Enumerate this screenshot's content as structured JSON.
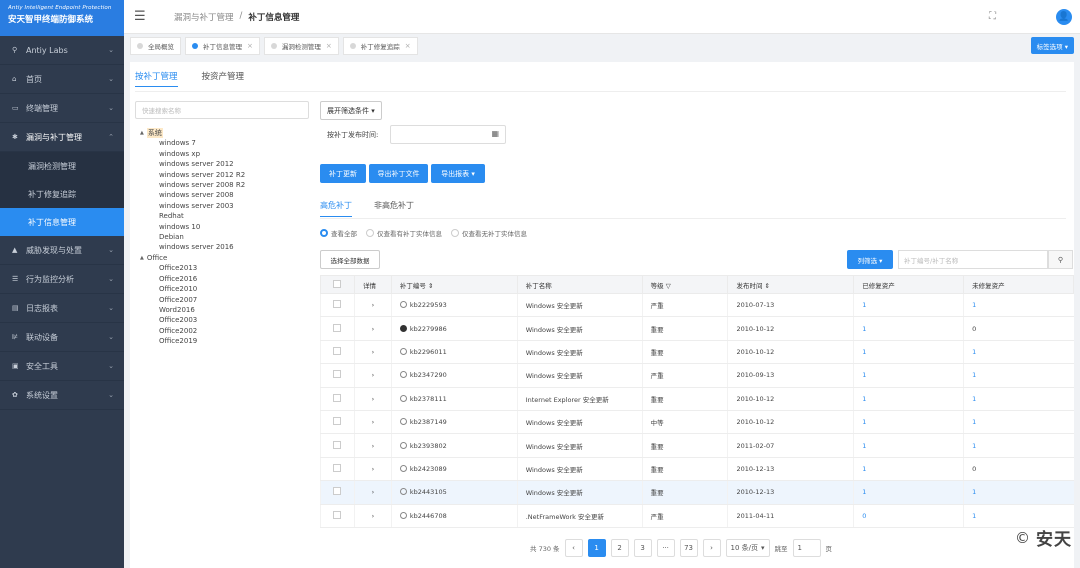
{
  "brand": {
    "en": "Antiy Intelligent Endpoint Protection",
    "zh": "安天智甲终端防御系统"
  },
  "sidebar": {
    "items": [
      {
        "icon": "⚲",
        "label": "Antiy Labs",
        "chev": "⌄"
      },
      {
        "icon": "⌂",
        "label": "首页",
        "chev": "⌄"
      },
      {
        "icon": "▭",
        "label": "终端管理",
        "chev": "⌄"
      },
      {
        "icon": "✱",
        "label": "漏洞与补丁管理",
        "chev": "⌃"
      },
      {
        "icon": "▲",
        "label": "威胁发现与处置",
        "chev": "⌄"
      },
      {
        "icon": "☰",
        "label": "行为监控分析",
        "chev": "⌄"
      },
      {
        "icon": "▤",
        "label": "日志报表",
        "chev": "⌄"
      },
      {
        "icon": "⊯",
        "label": "联动设备",
        "chev": "⌄"
      },
      {
        "icon": "▣",
        "label": "安全工具",
        "chev": "⌄"
      },
      {
        "icon": "✿",
        "label": "系统设置",
        "chev": "⌄"
      }
    ],
    "sub_items": [
      "漏洞检测管理",
      "补丁修复追踪",
      "补丁信息管理"
    ]
  },
  "header": {
    "menu_icon": "☰",
    "crumb_parent": "漏洞与补丁管理",
    "crumb_sep": "/",
    "crumb_current": "补丁信息管理",
    "fullscreen_icon": "⛶",
    "avatar_icon": "👤"
  },
  "tabs": {
    "items": [
      {
        "label": "全局概览",
        "close": ""
      },
      {
        "label": "补丁信息管理",
        "close": "×"
      },
      {
        "label": "漏洞检测管理",
        "close": "×"
      },
      {
        "label": "补丁修复追踪",
        "close": "×"
      }
    ],
    "options": "标签选项 ▾"
  },
  "subtabs": [
    "按补丁管理",
    "按资产管理"
  ],
  "tree": {
    "search_placeholder": "快速搜索名称",
    "groups": [
      {
        "caret": "▲",
        "label": "系统",
        "leaves": [
          "windows 7",
          "windows xp",
          "windows server 2012",
          "windows server 2012 R2",
          "windows server 2008 R2",
          "windows server 2008",
          "windows server 2003",
          "Redhat",
          "windows 10",
          "Debian",
          "windows server 2016"
        ]
      },
      {
        "caret": "▲",
        "label": "Office",
        "leaves": [
          "Office2013",
          "Office2016",
          "Office2010",
          "Office2007",
          "Word2016",
          "Office2003",
          "Office2002",
          "Office2019"
        ]
      }
    ]
  },
  "filters": {
    "expand_label": "展开筛选条件 ▾",
    "date_label": "按补丁发布时间:",
    "calendar_icon": "▦"
  },
  "actions": {
    "update": "补丁更新",
    "export_file": "导出补丁文件",
    "export_report": "导出报表 ▾"
  },
  "level_tabs": [
    "高危补丁",
    "非高危补丁"
  ],
  "radios": [
    "查看全部",
    "仅查看有补丁实体信息",
    "仅查看无补丁实体信息"
  ],
  "table_tools": {
    "select_all": "选择全部数据",
    "filter": "列筛选 ▾",
    "search_placeholder": "补丁编号/补丁名称",
    "search_icon": "⚲"
  },
  "table": {
    "headers": [
      "",
      "详情",
      "补丁编号 ⇕",
      "补丁名称",
      "等级 ▽",
      "发布时间 ⇕",
      "已修复资产",
      "未修复资产"
    ],
    "expander": "›",
    "rows": [
      {
        "status": "o",
        "id": "kb2229593",
        "name": "Windows 安全更新",
        "level": "严重",
        "date": "2010-07-13",
        "fixed": "1",
        "unfixed": "1"
      },
      {
        "status": "d",
        "id": "kb2279986",
        "name": "Windows 安全更新",
        "level": "重要",
        "date": "2010-10-12",
        "fixed": "1",
        "unfixed": "0"
      },
      {
        "status": "o",
        "id": "kb2296011",
        "name": "Windows 安全更新",
        "level": "重要",
        "date": "2010-10-12",
        "fixed": "1",
        "unfixed": "1"
      },
      {
        "status": "o",
        "id": "kb2347290",
        "name": "Windows 安全更新",
        "level": "严重",
        "date": "2010-09-13",
        "fixed": "1",
        "unfixed": "1"
      },
      {
        "status": "o",
        "id": "kb2378111",
        "name": "Internet Explorer 安全更新",
        "level": "重要",
        "date": "2010-10-12",
        "fixed": "1",
        "unfixed": "1"
      },
      {
        "status": "o",
        "id": "kb2387149",
        "name": "Windows 安全更新",
        "level": "中等",
        "date": "2010-10-12",
        "fixed": "1",
        "unfixed": "1"
      },
      {
        "status": "o",
        "id": "kb2393802",
        "name": "Windows 安全更新",
        "level": "重要",
        "date": "2011-02-07",
        "fixed": "1",
        "unfixed": "1"
      },
      {
        "status": "o",
        "id": "kb2423089",
        "name": "Windows 安全更新",
        "level": "重要",
        "date": "2010-12-13",
        "fixed": "1",
        "unfixed": "0"
      },
      {
        "status": "o",
        "id": "kb2443105",
        "name": "Windows 安全更新",
        "level": "重要",
        "date": "2010-12-13",
        "fixed": "1",
        "unfixed": "1"
      },
      {
        "status": "o",
        "id": "kb2446708",
        "name": ".NetFrameWork 安全更新",
        "level": "严重",
        "date": "2011-04-11",
        "fixed": "0",
        "unfixed": "1"
      }
    ]
  },
  "pager": {
    "total": "共 730 条",
    "prev": "‹",
    "pages": [
      "1",
      "2",
      "3",
      "···",
      "73"
    ],
    "next": "›",
    "size": "10 条/页",
    "size_caret": "▾",
    "goto": "跳至",
    "goto_value": "1",
    "page_unit": "页"
  },
  "watermark": {
    "copy": "©",
    "logo": "安天"
  }
}
